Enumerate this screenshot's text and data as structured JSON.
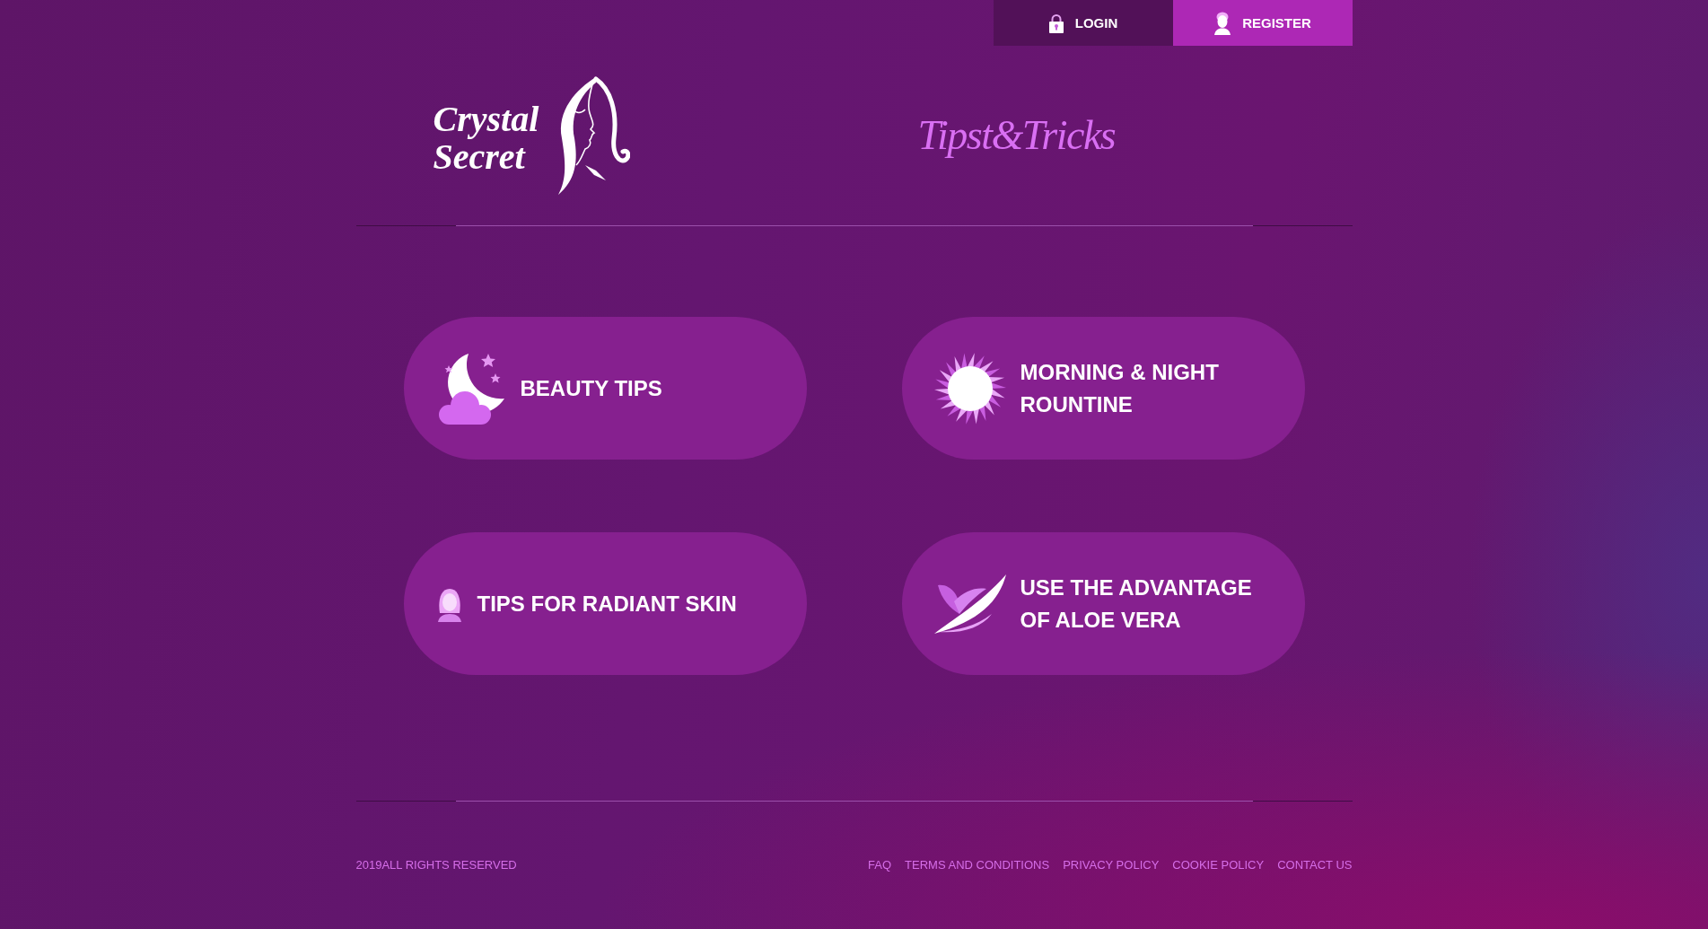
{
  "top_bar": {
    "buttons": [
      {
        "label": "LOGIN",
        "kind": "login"
      },
      {
        "label": "REGISTER",
        "kind": "register"
      }
    ]
  },
  "header": {
    "logo": {
      "text": "Crystal Secret"
    },
    "tagline": "Tipst&Tricks"
  },
  "categories": [
    {
      "label": "BEAUTY TIPS",
      "kind": "moon"
    },
    {
      "label": "MORNING & NIGHT ROUNTINE",
      "kind": "sun"
    },
    {
      "label": "TIPS FOR RADIANT SKIN",
      "kind": "woman"
    },
    {
      "label": "USE THE ADVANTAGE OF ALOE VERA",
      "kind": "leaf"
    }
  ],
  "footer": {
    "copyright": "2019ALL RIGHTS RESERVED",
    "links": [
      "FAQ",
      "TERMS AND CONDITIONS",
      "PRIVACY POLICY",
      "COOKIE POLICY",
      "CONTACT US"
    ]
  }
}
